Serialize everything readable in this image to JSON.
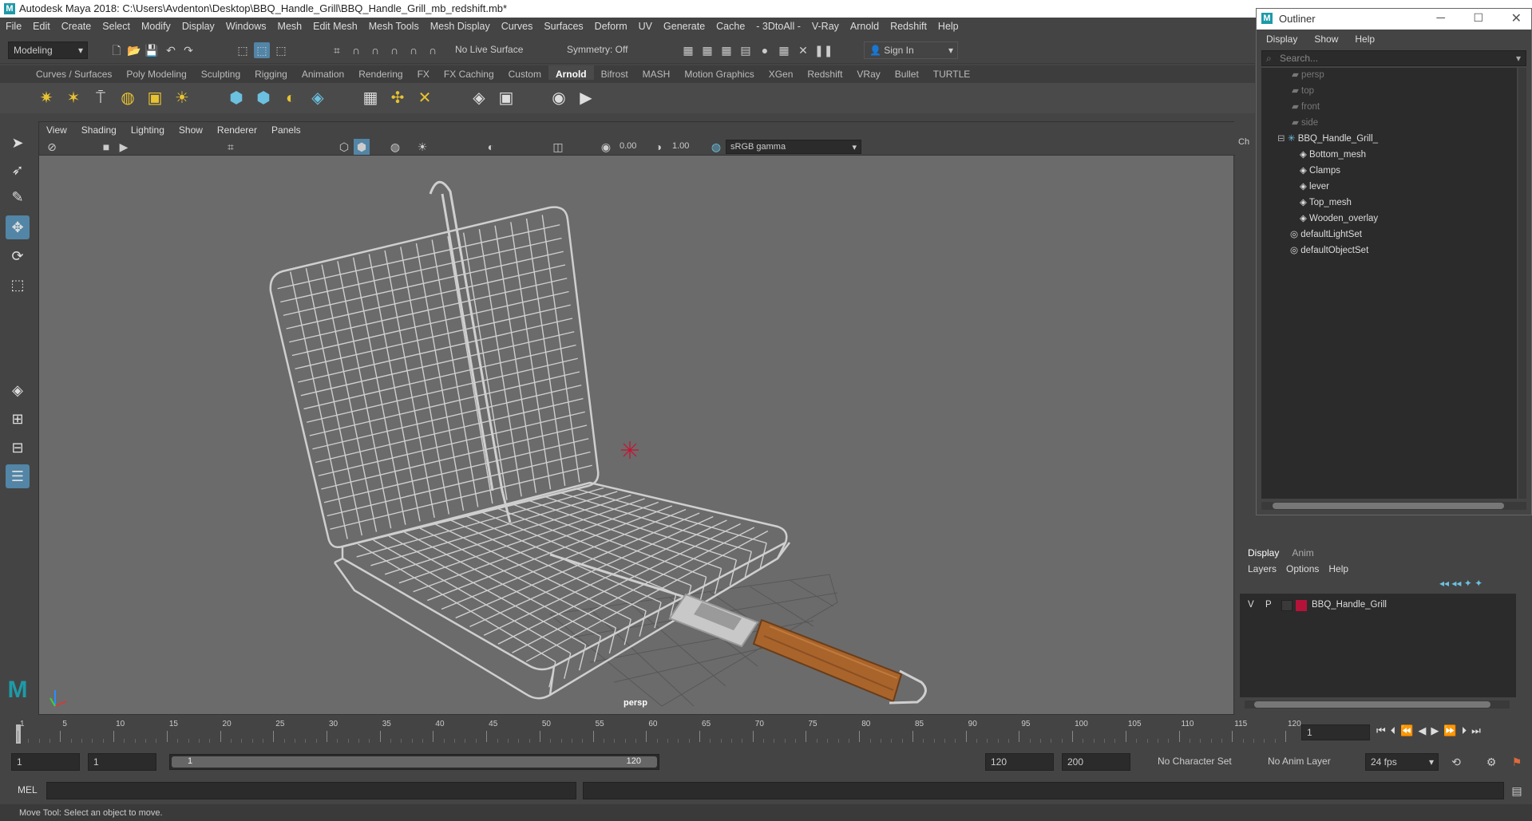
{
  "title": "Autodesk Maya 2018: C:\\Users\\Avdenton\\Desktop\\BBQ_Handle_Grill\\BBQ_Handle_Grill_mb_redshift.mb*",
  "menu": [
    "File",
    "Edit",
    "Create",
    "Select",
    "Modify",
    "Display",
    "Windows",
    "Mesh",
    "Edit Mesh",
    "Mesh Tools",
    "Mesh Display",
    "Curves",
    "Surfaces",
    "Deform",
    "UV",
    "Generate",
    "Cache",
    "- 3DtoAll -",
    "V-Ray",
    "Arnold",
    "Redshift",
    "Help"
  ],
  "status": {
    "mode": "Modeling",
    "live_surface": "No Live Surface",
    "symmetry": "Symmetry: Off",
    "sign_in": "Sign In"
  },
  "shelf_tabs": [
    "Curves / Surfaces",
    "Poly Modeling",
    "Sculpting",
    "Rigging",
    "Animation",
    "Rendering",
    "FX",
    "FX Caching",
    "Custom",
    "Arnold",
    "Bifrost",
    "MASH",
    "Motion Graphics",
    "XGen",
    "Redshift",
    "VRay",
    "Bullet",
    "TURTLE"
  ],
  "shelf_active": "Arnold",
  "viewport": {
    "menu": [
      "View",
      "Shading",
      "Lighting",
      "Show",
      "Renderer",
      "Panels"
    ],
    "exposure": "0.00",
    "gamma": "1.00",
    "color_space": "sRGB gamma",
    "camera_label": "persp"
  },
  "channel_tab": "Ch",
  "outliner": {
    "title": "Outliner",
    "menu": [
      "Display",
      "Show",
      "Help"
    ],
    "search_placeholder": "Search...",
    "cameras": [
      "persp",
      "top",
      "front",
      "side"
    ],
    "group": "BBQ_Handle_Grill_",
    "children": [
      "Bottom_mesh",
      "Clamps",
      "lever",
      "Top_mesh",
      "Wooden_overlay"
    ],
    "sets": [
      "defaultLightSet",
      "defaultObjectSet"
    ]
  },
  "layers": {
    "tabs": [
      "Display",
      "Anim"
    ],
    "menu": [
      "Layers",
      "Options",
      "Help"
    ],
    "layer": {
      "v": "V",
      "p": "P",
      "name": "BBQ_Handle_Grill",
      "color": "#b5123a"
    }
  },
  "timeline": {
    "ticks": [
      "1",
      "5",
      "10",
      "15",
      "20",
      "25",
      "30",
      "35",
      "40",
      "45",
      "50",
      "55",
      "60",
      "65",
      "70",
      "75",
      "80",
      "85",
      "90",
      "95",
      "100",
      "105",
      "110",
      "115",
      "120"
    ],
    "current_frame": "1"
  },
  "range": {
    "start": "1",
    "anim_start": "1",
    "range_start": "1",
    "range_end": "120",
    "end": "120",
    "anim_end": "200",
    "character_set": "No Character Set",
    "anim_layer": "No Anim Layer",
    "fps": "24 fps"
  },
  "cmd": {
    "label": "MEL"
  },
  "help_line": "Move Tool: Select an object to move.",
  "colors": {
    "maya_teal": "#1e9aa8",
    "accent_blue": "#5285a6"
  }
}
